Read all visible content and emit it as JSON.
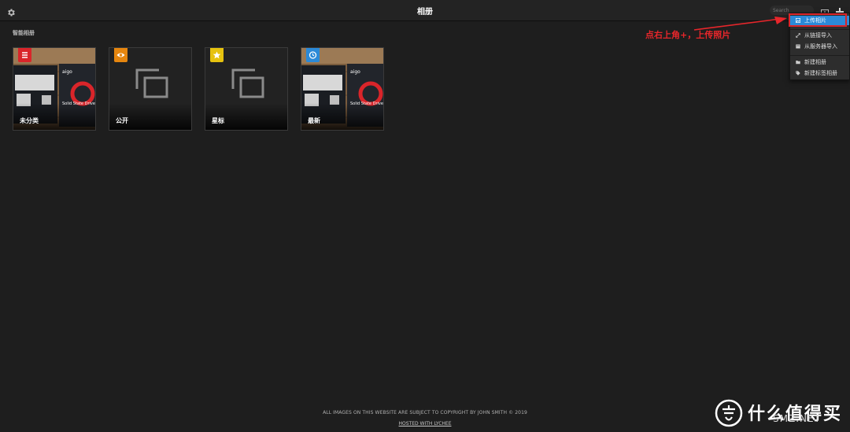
{
  "header": {
    "title": "相册",
    "search_placeholder": "Search"
  },
  "section": {
    "smart_albums_title": "智能相册"
  },
  "albums": [
    {
      "label": "未分类",
      "badge_color": "#d9252a",
      "badge_icon": "list-icon",
      "thumbnail": "photo"
    },
    {
      "label": "公开",
      "badge_color": "#e6860f",
      "badge_icon": "eye-icon",
      "thumbnail": "placeholder"
    },
    {
      "label": "星标",
      "badge_color": "#e6c20f",
      "badge_icon": "star-icon",
      "thumbnail": "placeholder"
    },
    {
      "label": "最新",
      "badge_color": "#2b8ad8",
      "badge_icon": "clock-icon",
      "thumbnail": "photo"
    }
  ],
  "photo_thumbnail": {
    "brand": "aigo",
    "product": "Solid State Drive"
  },
  "menu": {
    "items": [
      {
        "label": "上传相片",
        "icon": "image-icon",
        "active": true
      },
      {
        "label": "从链接导入",
        "icon": "link-icon",
        "active": false
      },
      {
        "label": "从服务器导入",
        "icon": "server-icon",
        "active": false
      },
      {
        "label": "新建相册",
        "icon": "folder-icon",
        "active": false
      },
      {
        "label": "新建标签相册",
        "icon": "tag-icon",
        "active": false
      }
    ]
  },
  "annotation": {
    "text": "点右上角+，上传照片",
    "color": "#e8262b"
  },
  "footer": {
    "copyright": "ALL IMAGES ON THIS WEBSITE ARE SUBJECT TO COPYRIGHT BY JOHN SMITH © 2019",
    "hosted": "HOSTED WITH LYCHEE"
  },
  "watermark": {
    "text": "什么值得买",
    "sub": "SMZ.NET"
  },
  "colors": {
    "background": "#1e1e1e",
    "header": "#232323",
    "accent": "#2b8ad8",
    "highlight": "#d9252a"
  }
}
